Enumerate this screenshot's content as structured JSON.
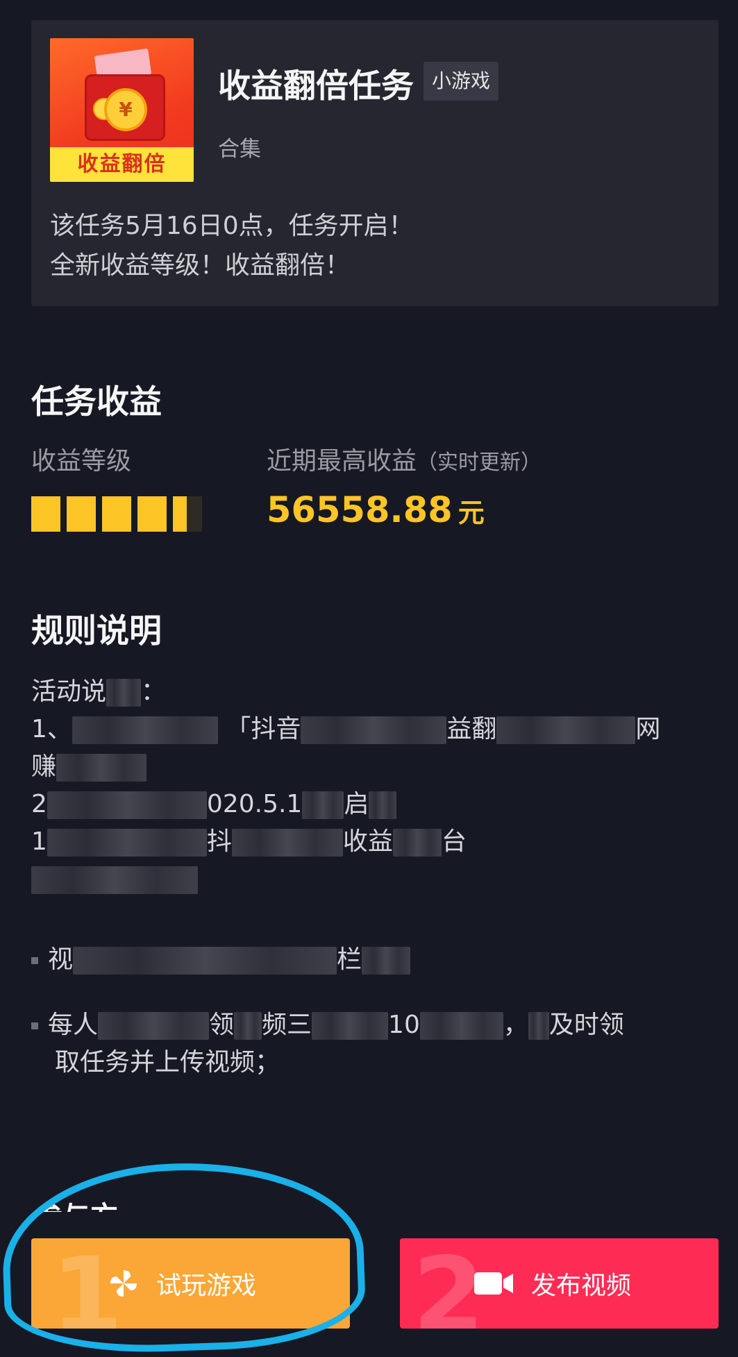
{
  "card": {
    "thumbnail_label": "收益翻倍",
    "thumbnail_coin": "¥",
    "title": "收益翻倍任务",
    "tag": "小游戏",
    "subtitle": "合集",
    "description_line1": "该任务5月16日0点，任务开启！",
    "description_line2": "全新收益等级！收益翻倍！"
  },
  "income": {
    "heading": "任务收益",
    "level_label": "收益等级",
    "recent_label": "近期最高收益",
    "recent_note": "（实时更新）",
    "level_fraction": 0.9,
    "amount": "56558.88",
    "unit": "元"
  },
  "rules": {
    "heading": "规则说明",
    "line1": "活动说",
    "line2a": "1、",
    "line2b": "「抖音",
    "line2c": "益翻",
    "line2d": "网",
    "line3": "赚",
    "line4a": "2",
    "line4b": "020.5.1",
    "line4c": "启",
    "line5a": "1",
    "line5b": "抖",
    "line5c": "收益",
    "line5d": "台",
    "bullet1": "视",
    "bullet1b": "栏",
    "bullet2a": "每人",
    "bullet2b": "领",
    "bullet2c": "频三",
    "bullet2d": "10",
    "bullet2e": "，",
    "bullet2f": "及时领",
    "bullet2_line2": "取任务并上传视频；"
  },
  "participant_heading": "参与方",
  "actions": {
    "play_number": "1",
    "play_label": "试玩游戏",
    "publish_number": "2",
    "publish_label": "发布视频"
  },
  "colors": {
    "background": "#161823",
    "accent_yellow": "#fcc526",
    "play_button": "#faa738",
    "publish_button": "#fe2c55",
    "annotation_circle": "#1ab0e8"
  },
  "icons": {
    "play": "pinwheel-icon",
    "publish": "video-camera-icon"
  }
}
